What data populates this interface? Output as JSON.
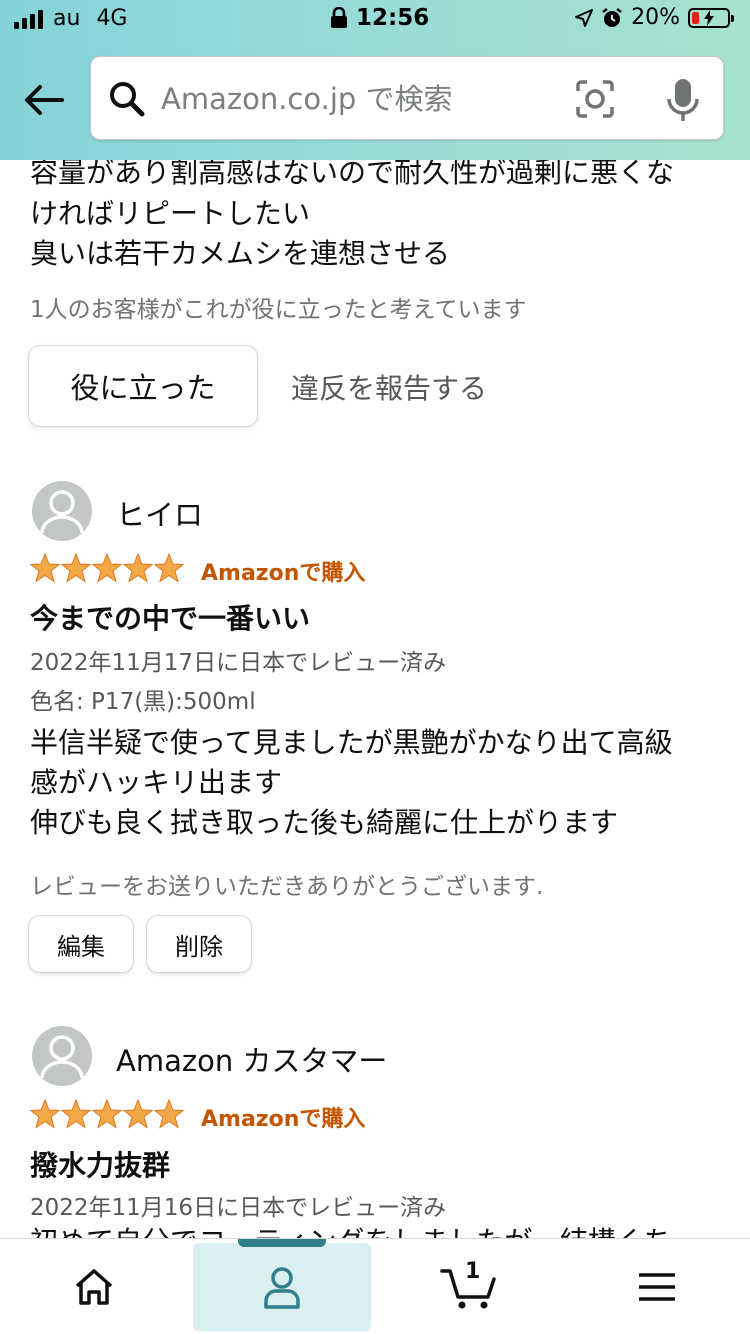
{
  "status_bar": {
    "carrier": "au",
    "network": "4G",
    "time": "12:56",
    "battery_pct": "20%",
    "battery_level": 0.2,
    "signal_icon": "signal-bars-icon",
    "lock_icon": "lock-icon",
    "location_icon": "location-arrow-icon",
    "alarm_icon": "alarm-icon"
  },
  "header": {
    "back_icon": "back-arrow-icon",
    "search": {
      "placeholder": "Amazon.co.jp で検索",
      "search_icon": "search-icon",
      "camera_icon": "camera-scan-icon",
      "mic_icon": "microphone-icon"
    },
    "gradient_colors": [
      "#84d3d8",
      "#a8e2cf"
    ]
  },
  "previous_review": {
    "lines": [
      "容量があり割高感はないので耐久性が過剰に悪くな",
      "ければリピートしたい",
      "臭いは若干カメムシを連想させる"
    ],
    "helpful_count_text": "1人のお客様がこれが役に立ったと考えています",
    "helpful_button": "役に立った",
    "report_link": "違反を報告する"
  },
  "reviews": [
    {
      "reviewer": "ヒイロ",
      "rating": 5,
      "purchase_badge": "Amazonで購入",
      "title": "今までの中で一番いい",
      "date": "2022年11月17日に日本でレビュー済み",
      "variant": "色名: P17(黒):500ml",
      "body_lines": [
        "半信半疑で使って見ましたが黒艶がかなり出て高級",
        "感がハッキリ出ます",
        "伸びも良く拭き取った後も綺麗に仕上がります"
      ],
      "thanks": "レビューをお送りいただきありがとうございます.",
      "edit_button": "編集",
      "delete_button": "削除"
    },
    {
      "reviewer": "Amazon カスタマー",
      "rating": 5,
      "purchase_badge": "Amazonで購入",
      "title": "撥水力抜群",
      "date": "2022年11月16日に日本でレビュー済み",
      "body_lines": [
        "初めて自分でコーティングをしましたが、結構くち"
      ]
    }
  ],
  "bottom_nav": {
    "items": [
      {
        "icon": "home-icon"
      },
      {
        "icon": "account-icon"
      },
      {
        "icon": "cart-icon",
        "count": "1"
      },
      {
        "icon": "menu-icon"
      }
    ],
    "active_index": 1,
    "accent": "#2f7f8d"
  },
  "colors": {
    "star": "#f3a847",
    "badge": "#c45500",
    "muted_text": "#565959"
  }
}
